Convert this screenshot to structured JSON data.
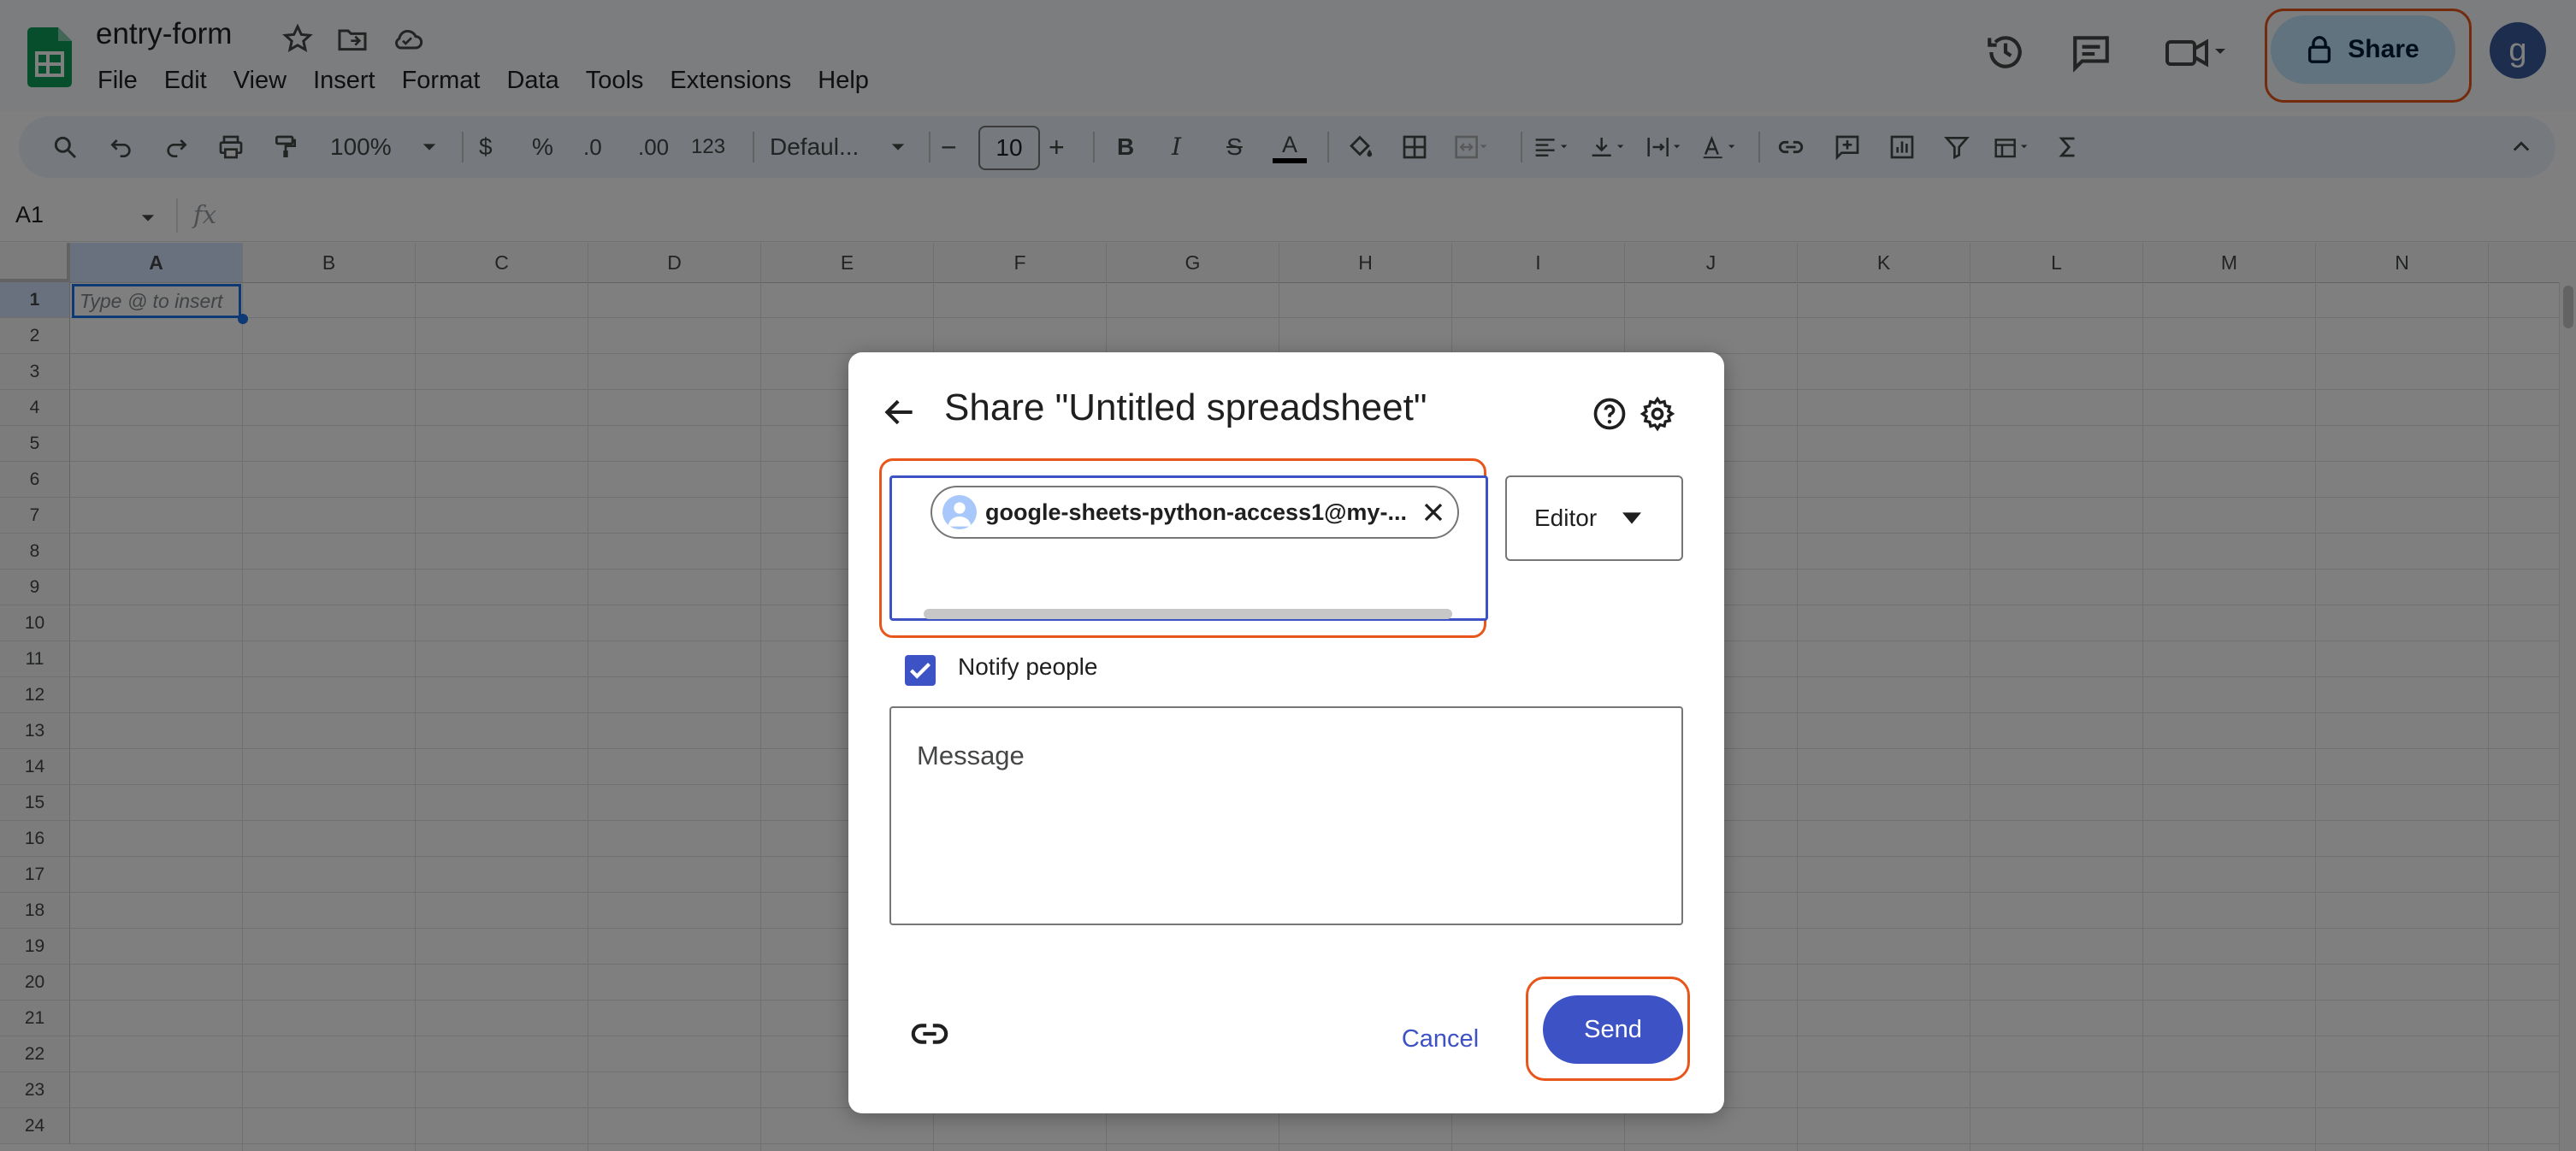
{
  "document": {
    "title": "entry-form"
  },
  "menu": [
    "File",
    "Edit",
    "View",
    "Insert",
    "Format",
    "Data",
    "Tools",
    "Extensions",
    "Help"
  ],
  "header": {
    "share_label": "Share",
    "avatar_letter": "g"
  },
  "toolbar": {
    "zoom": "100%",
    "currency": "$",
    "percent": "%",
    "dec_decrease": ".0",
    "dec_increase": ".00",
    "number_format": "123",
    "font": "Defaul...",
    "font_size": "10",
    "minus": "−",
    "plus": "+",
    "bold": "B",
    "italic": "I",
    "strike": "S",
    "text_color": "A"
  },
  "formula_bar": {
    "cell_ref": "A1",
    "fx": "fx"
  },
  "grid": {
    "columns": [
      "A",
      "B",
      "C",
      "D",
      "E",
      "F",
      "G",
      "H",
      "I",
      "J",
      "K",
      "L",
      "M",
      "N"
    ],
    "rows": [
      "1",
      "2",
      "3",
      "4",
      "5",
      "6",
      "7",
      "8",
      "9",
      "10",
      "11",
      "12",
      "13",
      "14",
      "15",
      "16",
      "17",
      "18",
      "19",
      "20",
      "21",
      "22",
      "23",
      "24"
    ],
    "a1_placeholder": "Type @ to insert"
  },
  "dialog": {
    "title": "Share \"Untitled spreadsheet\"",
    "chip_email": "google-sheets-python-access1@my-...",
    "role": "Editor",
    "notify_label": "Notify people",
    "notify_checked": true,
    "message_placeholder": "Message",
    "cancel_label": "Cancel",
    "send_label": "Send"
  },
  "colors": {
    "accent": "#3d52c5",
    "highlight": "#e8561b",
    "share_bg": "#c2e7ff"
  }
}
